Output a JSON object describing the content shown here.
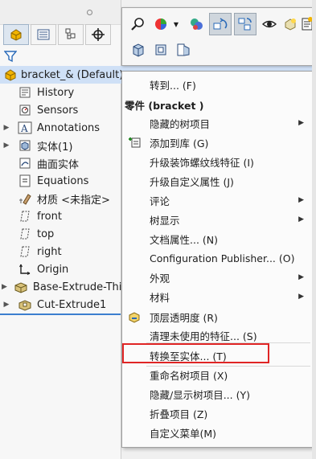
{
  "tree": {
    "root_label": "bracket_& (Default) <",
    "items": [
      {
        "label": "History",
        "expand": "",
        "icon": "history-icon"
      },
      {
        "label": "Sensors",
        "expand": "",
        "icon": "sensor-icon"
      },
      {
        "label": "Annotations",
        "expand": "▶",
        "icon": "annotations-icon"
      },
      {
        "label": "实体(1)",
        "expand": "▶",
        "icon": "solid-bodies-icon"
      },
      {
        "label": "曲面实体",
        "expand": "",
        "icon": "surface-bodies-icon"
      },
      {
        "label": "Equations",
        "expand": "",
        "icon": "equations-icon"
      },
      {
        "label": "材质 <未指定>",
        "expand": "",
        "icon": "material-icon"
      },
      {
        "label": "front",
        "expand": "",
        "icon": "plane-icon"
      },
      {
        "label": "top",
        "expand": "",
        "icon": "plane-icon"
      },
      {
        "label": "right",
        "expand": "",
        "icon": "plane-icon"
      },
      {
        "label": "Origin",
        "expand": "",
        "icon": "origin-icon"
      },
      {
        "label": "Base-Extrude-Thin",
        "expand": "▶",
        "icon": "extrude-icon"
      },
      {
        "label": "Cut-Extrude1",
        "expand": "▶",
        "icon": "cut-extrude-icon"
      }
    ]
  },
  "menu": {
    "goto": "转到... (F)",
    "header": "零件 (bracket )",
    "items": [
      {
        "label": "隐藏的树项目",
        "submenu": true
      },
      {
        "label": "添加到库 (G)",
        "submenu": false
      },
      {
        "label": "升级装饰螺纹线特征 (I)",
        "submenu": false
      },
      {
        "label": "升级自定义属性 (J)",
        "submenu": false
      },
      {
        "label": "评论",
        "submenu": true
      },
      {
        "label": "树显示",
        "submenu": true
      },
      {
        "label": "文档属性... (N)",
        "submenu": false
      },
      {
        "label": "Configuration Publisher... (O)",
        "submenu": false
      },
      {
        "label": "外观",
        "submenu": true
      },
      {
        "label": "材料",
        "submenu": true
      },
      {
        "label": "顶层透明度 (R)",
        "submenu": false
      },
      {
        "label": "清理未使用的特征... (S)",
        "submenu": false
      },
      {
        "label": "转换至实体... (T)",
        "submenu": false
      },
      {
        "label": "重命名树项目 (X)",
        "submenu": false
      },
      {
        "label": "隐藏/显示树项目... (Y)",
        "submenu": false
      },
      {
        "label": "折叠项目 (Z)",
        "submenu": false
      },
      {
        "label": "自定义菜单(M)",
        "submenu": false
      }
    ]
  },
  "colors": {
    "highlight": "#e02525",
    "selection": "#cfe0f6",
    "accent": "#3c7fcf"
  }
}
